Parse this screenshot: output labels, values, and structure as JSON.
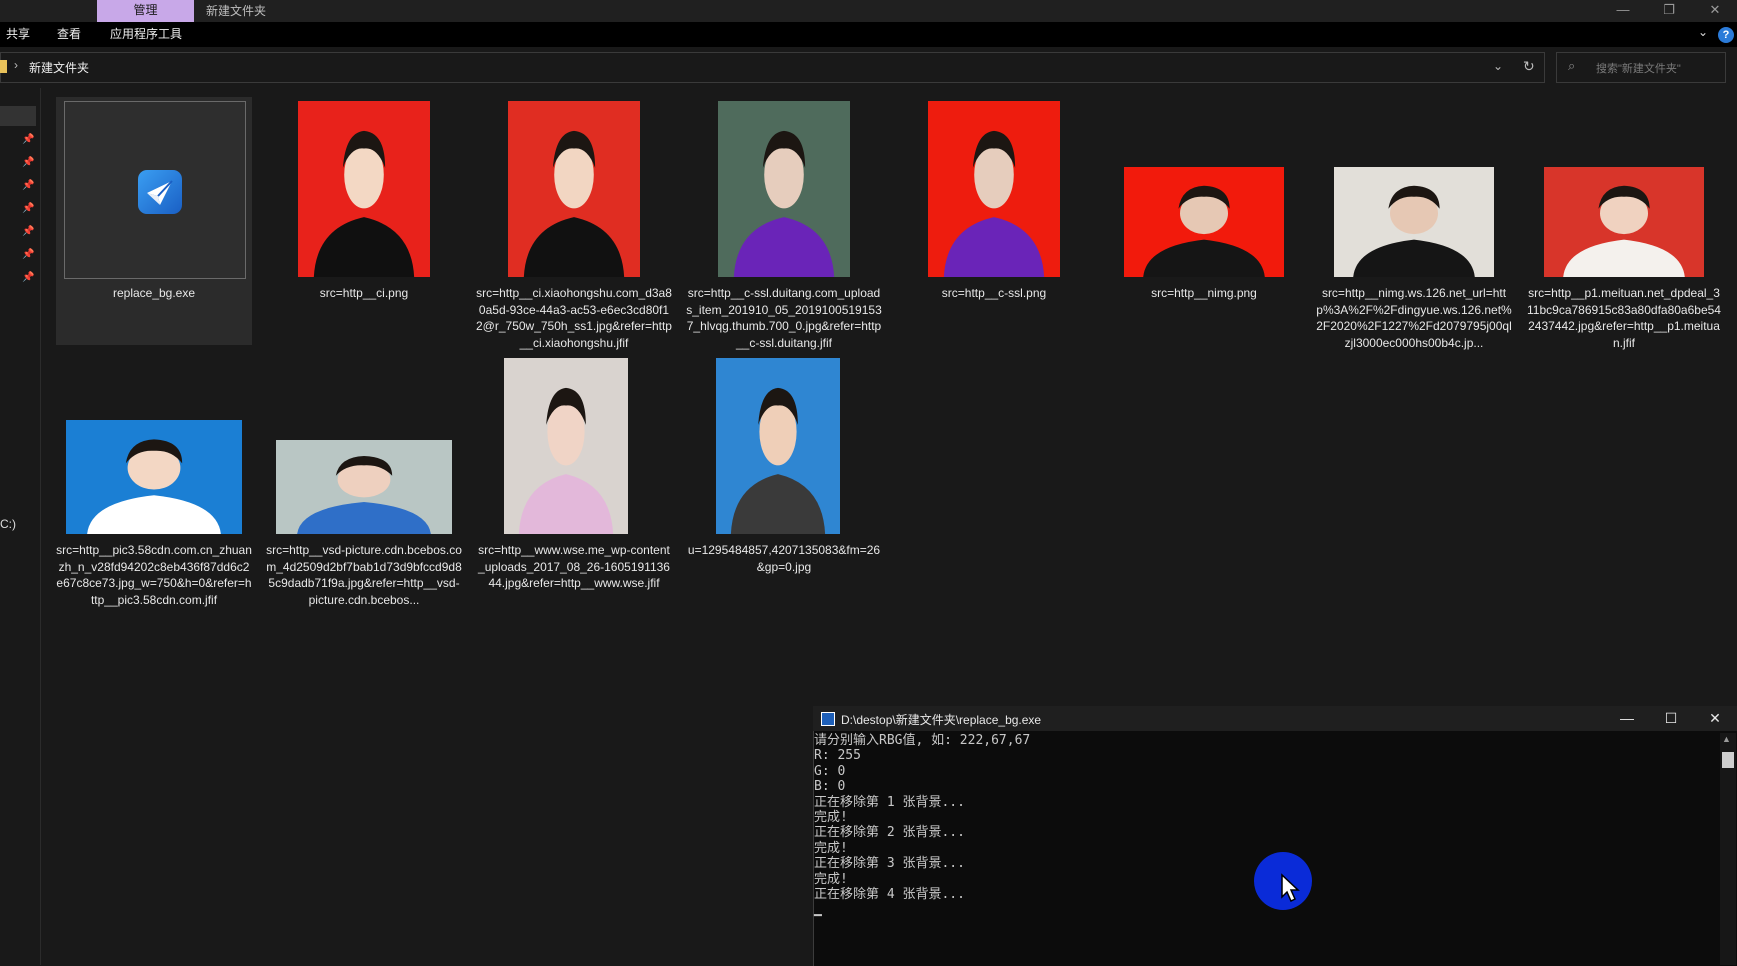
{
  "titlebar": {
    "manage_tab": "管理",
    "folder_title": "新建文件夹",
    "minimize": "—",
    "restore": "❐",
    "close": "✕"
  },
  "ribbon": {
    "tabs": [
      "共享",
      "查看",
      "应用程序工具"
    ],
    "help_label": "?"
  },
  "address": {
    "path": "新建文件夹",
    "search_placeholder": "搜索\"新建文件夹\""
  },
  "nav": {
    "drive_label": "C:)"
  },
  "files": [
    {
      "name": "replace_bg.exe",
      "type": "exe",
      "thumb_bg": "#2e2e2e"
    },
    {
      "name": "src=http__ci.png",
      "type": "image",
      "thumb_bg": "#e8221b",
      "figure": "#f3d8c4",
      "clothes": "#101010"
    },
    {
      "name": "src=http__ci.xiaohongshu.com_d3a80a5d-93ce-44a3-ac53-e6ec3cd80f12@r_750w_750h_ss1.jpg&refer=http__ci.xiaohongshu.jfif",
      "type": "image",
      "thumb_bg": "#e02d22",
      "figure": "#f2d6c2",
      "clothes": "#111111"
    },
    {
      "name": "src=http__c-ssl.duitang.com_uploads_item_201910_05_20191005191537_hlvqg.thumb.700_0.jpg&refer=http__c-ssl.duitang.jfif",
      "type": "image",
      "thumb_bg": "#4f6b5c",
      "figure": "#e6cdbd",
      "clothes": "#6a24b8"
    },
    {
      "name": "src=http__c-ssl.png",
      "type": "image",
      "thumb_bg": "#ee1c0e",
      "figure": "#e6cdbd",
      "clothes": "#6a24b8"
    },
    {
      "name": "src=http__nimg.png",
      "type": "image",
      "thumb_bg": "#f21a0c",
      "figure": "#e6c8b4",
      "clothes": "#151515"
    },
    {
      "name": "src=http__nimg.ws.126.net_url=http%3A%2F%2Fdingyue.ws.126.net%2F2020%2F1227%2Fd2079795j00qlzjl3000ec000hs00b4c.jp...",
      "type": "image",
      "thumb_bg": "#e2dfd9",
      "figure": "#e6c8b4",
      "clothes": "#151515"
    },
    {
      "name": "src=http__p1.meituan.net_dpdeal_311bc9ca786915c83a80dfa80a6be542437442.jpg&refer=http__p1.meituan.jfif",
      "type": "image",
      "thumb_bg": "#d8352a",
      "figure": "#f0d2c0",
      "clothes": "#f4f1ed"
    },
    {
      "name": "src=http__pic3.58cdn.com.cn_zhuanzh_n_v28fd94202c8eb436f87dd6c2e67c8ce73.jpg_w=750&h=0&refer=http__pic3.58cdn.com.jfif",
      "type": "image",
      "thumb_bg": "#1b7fd4",
      "figure": "#f3d7c4",
      "clothes": "#ffffff"
    },
    {
      "name": "src=http__vsd-picture.cdn.bcebos.com_4d2509d2bf7bab1d73d9bfccd9d85c9dadb71f9a.jpg&refer=http__vsd-picture.cdn.bcebos...",
      "type": "image",
      "thumb_bg": "#b9c6c4",
      "figure": "#eed0bf",
      "clothes": "#2f6fc8"
    },
    {
      "name": "src=http__www.wse.me_wp-content_uploads_2017_08_26-160519113644.jpg&refer=http__www.wse.jfif",
      "type": "image",
      "thumb_bg": "#d9d3cf",
      "figure": "#f0d4c6",
      "clothes": "#e3b8da"
    },
    {
      "name": "u=1295484857,4207135083&fm=26&gp=0.jpg",
      "type": "image",
      "thumb_bg": "#2f86d2",
      "figure": "#efcfb8",
      "clothes": "#3a3a3a"
    }
  ],
  "console": {
    "title": "D:\\destop\\新建文件夹\\replace_bg.exe",
    "minimize": "—",
    "maximize": "☐",
    "close": "✕",
    "text": "请分别输入RBG值, 如: 222,67,67\nR: 255\nG: 0\nB: 0\n正在移除第 1 张背景...\n完成!\n正在移除第 2 张背景...\n完成!\n正在移除第 3 张背景...\n完成!\n正在移除第 4 张背景...\n▁",
    "scroll_up": "▲"
  }
}
